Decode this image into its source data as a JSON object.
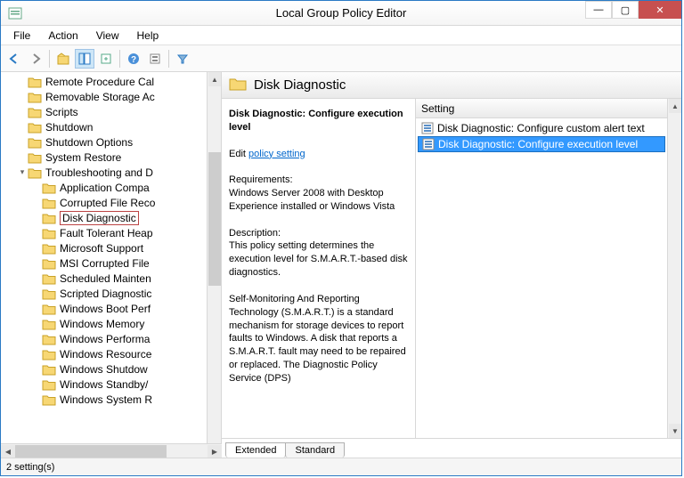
{
  "window": {
    "title": "Local Group Policy Editor"
  },
  "menu": {
    "file": "File",
    "action": "Action",
    "view": "View",
    "help": "Help"
  },
  "tree": {
    "items": [
      {
        "label": "Remote Procedure Cal",
        "indent": 1
      },
      {
        "label": "Removable Storage Ac",
        "indent": 1
      },
      {
        "label": "Scripts",
        "indent": 1
      },
      {
        "label": "Shutdown",
        "indent": 1
      },
      {
        "label": "Shutdown Options",
        "indent": 1
      },
      {
        "label": "System Restore",
        "indent": 1
      },
      {
        "label": "Troubleshooting and D",
        "indent": 1,
        "expander": "▾"
      },
      {
        "label": "Application Compa",
        "indent": 2
      },
      {
        "label": "Corrupted File Reco",
        "indent": 2
      },
      {
        "label": "Disk Diagnostic",
        "indent": 2,
        "selected": true
      },
      {
        "label": "Fault Tolerant Heap",
        "indent": 2
      },
      {
        "label": "Microsoft Support",
        "indent": 2
      },
      {
        "label": "MSI Corrupted File",
        "indent": 2
      },
      {
        "label": "Scheduled Mainten",
        "indent": 2
      },
      {
        "label": "Scripted Diagnostic",
        "indent": 2
      },
      {
        "label": "Windows Boot Perf",
        "indent": 2
      },
      {
        "label": "Windows Memory",
        "indent": 2
      },
      {
        "label": "Windows Performa",
        "indent": 2
      },
      {
        "label": "Windows Resource",
        "indent": 2
      },
      {
        "label": "Windows Shutdow",
        "indent": 2
      },
      {
        "label": "Windows Standby/",
        "indent": 2
      },
      {
        "label": "Windows System R",
        "indent": 2
      }
    ]
  },
  "right": {
    "header": "Disk Diagnostic",
    "desc": {
      "title": "Disk Diagnostic: Configure execution level",
      "edit_prefix": "Edit",
      "edit_link": "policy setting",
      "req_h": "Requirements:",
      "req_body": "Windows Server 2008 with Desktop Experience installed or Windows Vista",
      "desc_h": "Description:",
      "desc_body1": "This policy setting determines the execution level for S.M.A.R.T.-based disk diagnostics.",
      "desc_body2": "Self-Monitoring And Reporting Technology (S.M.A.R.T.) is a standard mechanism for storage devices to report faults to Windows. A disk that reports a S.M.A.R.T. fault may need to be repaired or replaced. The Diagnostic Policy Service (DPS)"
    },
    "list": {
      "header": "Setting",
      "rows": [
        {
          "label": "Disk Diagnostic: Configure custom alert text"
        },
        {
          "label": "Disk Diagnostic: Configure execution level",
          "selected": true
        }
      ]
    },
    "tabs": {
      "extended": "Extended",
      "standard": "Standard"
    }
  },
  "status": "2 setting(s)"
}
